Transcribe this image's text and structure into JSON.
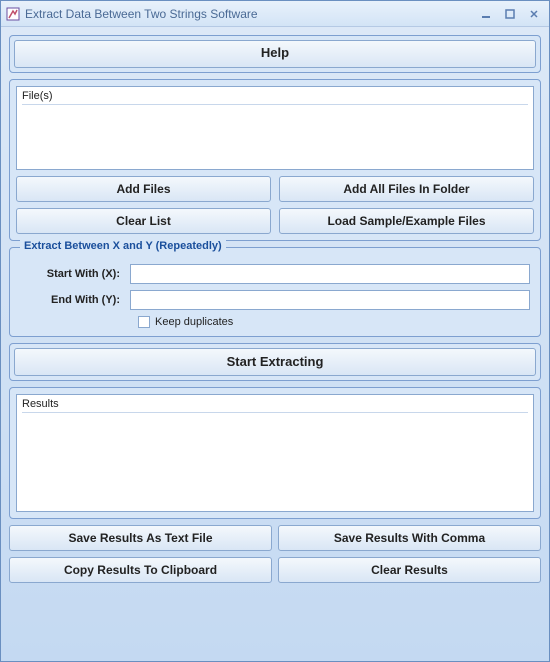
{
  "window": {
    "title": "Extract Data Between Two Strings Software"
  },
  "help": {
    "button": "Help"
  },
  "files": {
    "header": "File(s)",
    "add_files": "Add Files",
    "add_all_folder": "Add All Files In Folder",
    "clear_list": "Clear List",
    "load_sample": "Load Sample/Example Files"
  },
  "extract": {
    "legend": "Extract Between X and Y (Repeatedly)",
    "start_label": "Start With (X):",
    "end_label": "End With (Y):",
    "start_value": "",
    "end_value": "",
    "keep_dup": "Keep duplicates"
  },
  "actions": {
    "start": "Start Extracting"
  },
  "results": {
    "header": "Results",
    "save_text": "Save Results As Text File",
    "save_comma": "Save Results With Comma",
    "copy_clip": "Copy Results To Clipboard",
    "clear": "Clear Results"
  },
  "icons": {
    "app": "app-icon",
    "min": "minimize-icon",
    "max": "maximize-icon",
    "close": "close-icon"
  }
}
